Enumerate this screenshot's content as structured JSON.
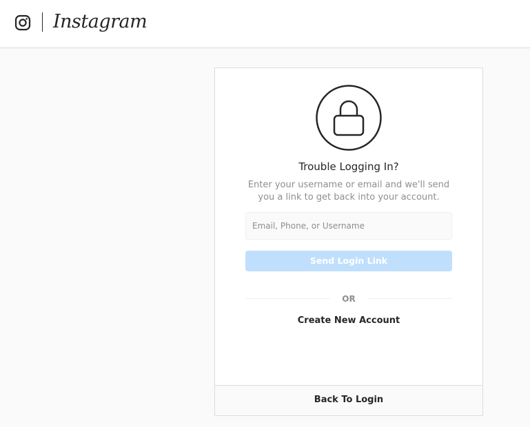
{
  "header": {
    "brand_icon": "instagram-glyph-icon",
    "wordmark": "Instagram"
  },
  "card": {
    "icon": "lock-icon",
    "title": "Trouble Logging In?",
    "subtitle": "Enter your username or email and we'll send you a link to get back into your account.",
    "input": {
      "placeholder": "Email, Phone, or Username",
      "value": ""
    },
    "send_button_label": "Send Login Link",
    "or_label": "OR",
    "create_account_label": "Create New Account",
    "back_to_login_label": "Back To Login"
  },
  "colors": {
    "button_disabled": "#c0dffd",
    "border": "#dbdbdb",
    "text_primary": "#262626",
    "text_secondary": "#8e8e8e"
  }
}
